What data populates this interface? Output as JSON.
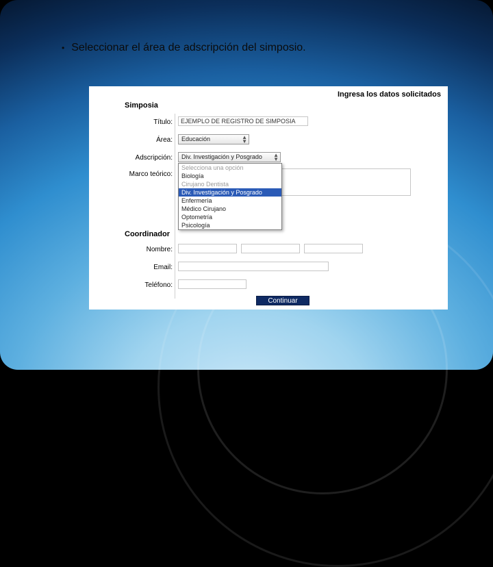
{
  "bullet": {
    "text": "Seleccionar el área de adscripción del simposio."
  },
  "panel": {
    "header": "Ingresa los datos solicitados",
    "section_simposia": "Simposia",
    "section_coordinador": "Coordinador",
    "labels": {
      "titulo": "Título:",
      "area": "Área:",
      "adscripcion": "Adscripción:",
      "marco": "Marco teórico:",
      "nombre": "Nombre:",
      "email": "Email:",
      "telefono": "Teléfono:"
    },
    "fields": {
      "titulo_value": "EJEMPLO DE REGISTRO DE SIMPOSIA",
      "area_value": "Educación",
      "adscripcion_value": "Div. Investigación y Posgrado"
    },
    "dropdown_options": [
      {
        "label": "Selecciona una opción",
        "disabled": true
      },
      {
        "label": "Biología"
      },
      {
        "label": "Cirujano Dentista",
        "disabled": true
      },
      {
        "label": "Div. Investigación y Posgrado",
        "highlight": true
      },
      {
        "label": "Enfermería"
      },
      {
        "label": "Médico Cirujano"
      },
      {
        "label": "Optometría"
      },
      {
        "label": "Psicología"
      }
    ],
    "continuar": "Continuar"
  }
}
